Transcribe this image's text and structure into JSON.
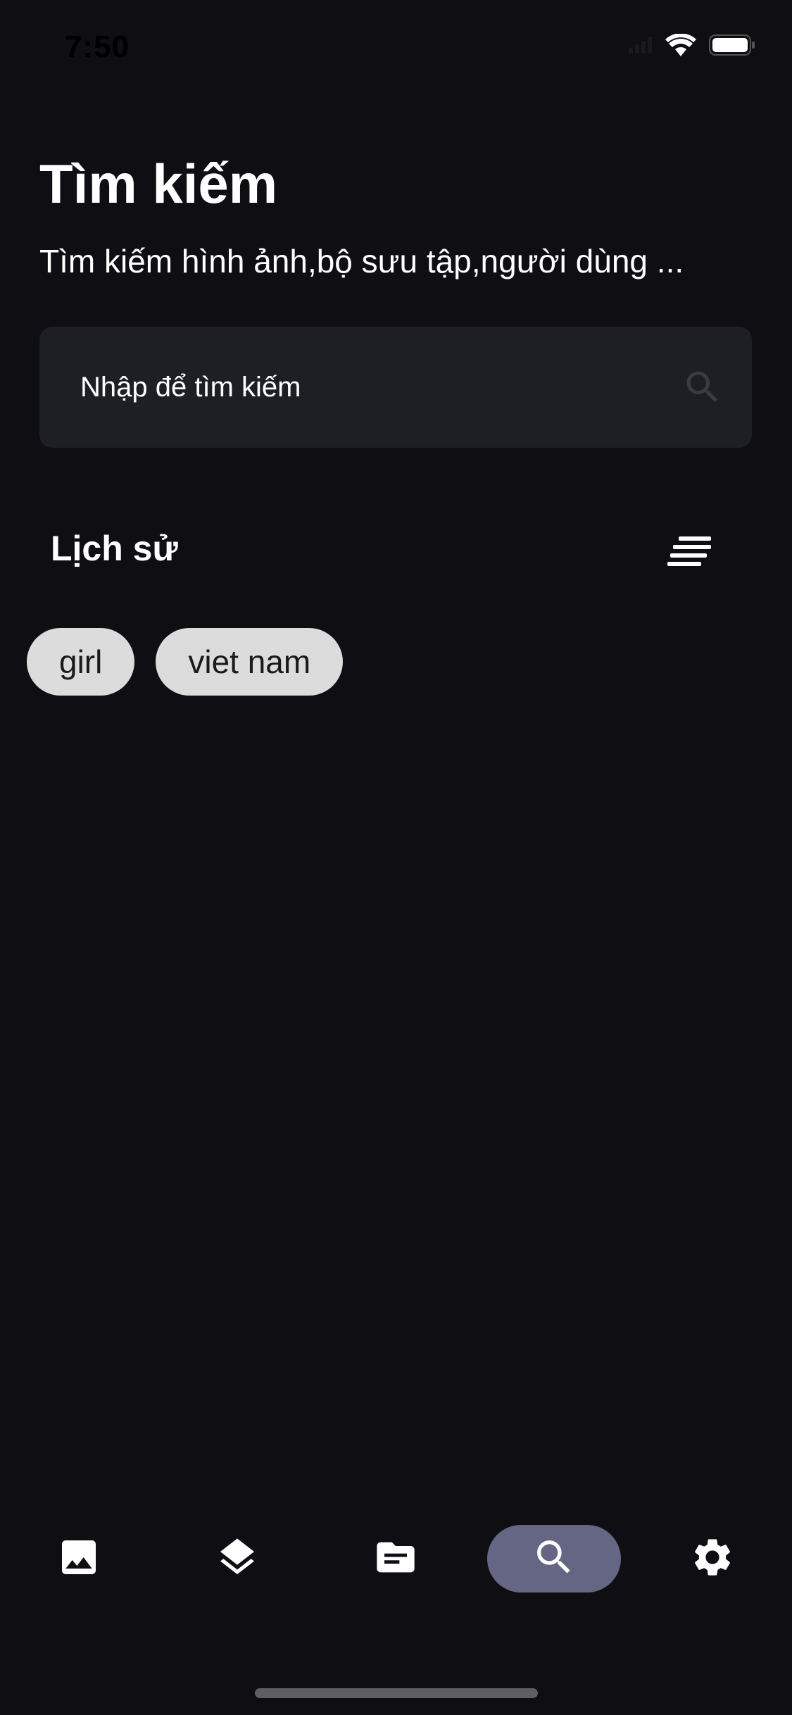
{
  "status_bar": {
    "time": "7:50"
  },
  "header": {
    "title": "Tìm kiếm",
    "subtitle": "Tìm kiếm hình ảnh,bộ sưu tập,người dùng ..."
  },
  "search": {
    "placeholder": "Nhập để tìm kiếm",
    "value": "",
    "icon": "search-icon"
  },
  "history": {
    "title": "Lịch sử",
    "sort_icon": "sort-icon",
    "chips": [
      {
        "label": "girl"
      },
      {
        "label": "viet nam"
      }
    ]
  },
  "bottom_nav": {
    "items": [
      {
        "icon": "image-icon",
        "active": false
      },
      {
        "icon": "layers-icon",
        "active": false
      },
      {
        "icon": "folder-icon",
        "active": false
      },
      {
        "icon": "search-icon",
        "active": true
      },
      {
        "icon": "settings-icon",
        "active": false
      }
    ]
  },
  "colors": {
    "background": "#0E0E13",
    "search_field": "#1E1F25",
    "chip": "#DCDCDC",
    "nav_active": "#656584",
    "text": "#FFFFFF"
  }
}
